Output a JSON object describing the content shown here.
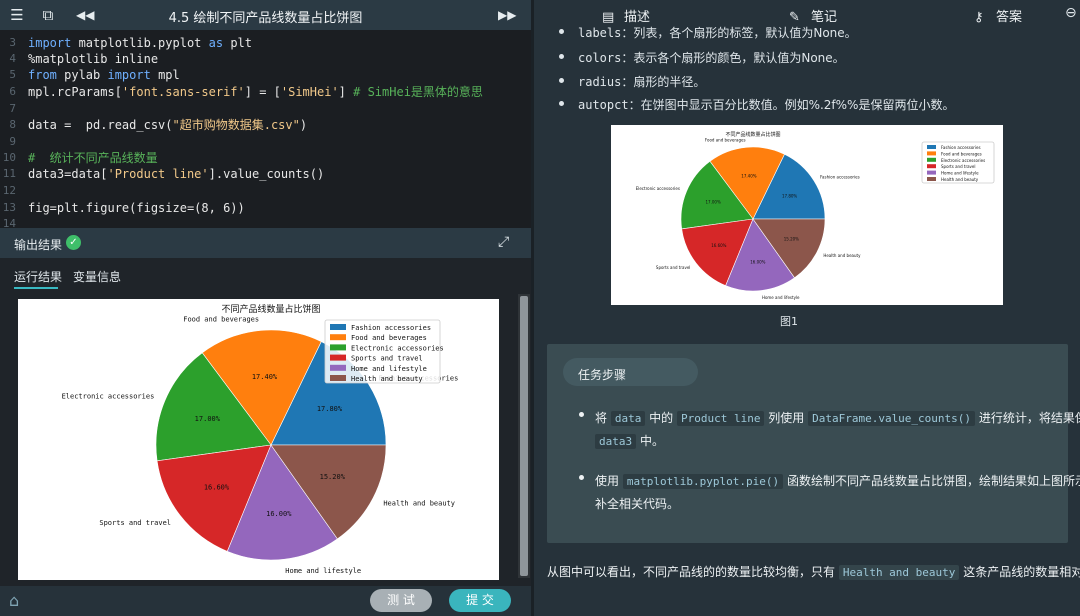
{
  "topbar": {
    "title": "4.5 绘制不同产品线数量占比饼图",
    "icons": [
      "menu-icon",
      "window-icon",
      "rewind-icon",
      "fast-forward-icon"
    ]
  },
  "editor": {
    "line_numbers": [
      "3",
      "4",
      "5",
      "6",
      "7",
      "8",
      "9",
      "10",
      "11",
      "12",
      "13",
      "14"
    ],
    "lines": [
      [
        {
          "t": "import",
          "c": "kw"
        },
        {
          "t": " matplotlib.pyplot ",
          "c": ""
        },
        {
          "t": "as",
          "c": "kw"
        },
        {
          "t": " plt",
          "c": ""
        }
      ],
      [
        {
          "t": "%matplotlib inline",
          "c": ""
        }
      ],
      [
        {
          "t": "from",
          "c": "kw"
        },
        {
          "t": " pylab ",
          "c": ""
        },
        {
          "t": "import",
          "c": "kw"
        },
        {
          "t": " mpl",
          "c": ""
        }
      ],
      [
        {
          "t": "mpl.rcParams[",
          "c": ""
        },
        {
          "t": "'font.sans-serif'",
          "c": "str"
        },
        {
          "t": "] = [",
          "c": ""
        },
        {
          "t": "'SimHei'",
          "c": "str"
        },
        {
          "t": "] ",
          "c": ""
        },
        {
          "t": "# SimHei是黑体的意思",
          "c": "cm"
        }
      ],
      [],
      [
        {
          "t": "data =  pd.read_csv(",
          "c": ""
        },
        {
          "t": "\"超市购物数据集.csv\"",
          "c": "str"
        },
        {
          "t": ")",
          "c": ""
        }
      ],
      [],
      [
        {
          "t": "#  统计不同产品线数量",
          "c": "cm"
        }
      ],
      [
        {
          "t": "data3=data[",
          "c": ""
        },
        {
          "t": "'Product line'",
          "c": "str"
        },
        {
          "t": "].value_counts()",
          "c": ""
        }
      ],
      [],
      [
        {
          "t": "fig=plt.figure(figsize=(8, 6))",
          "c": ""
        }
      ],
      []
    ]
  },
  "output": {
    "title": "输出结果",
    "tabs": [
      "运行结果",
      "变量信息"
    ],
    "active_tab": 0
  },
  "buttons": {
    "test": "测 试",
    "submit": "提 交"
  },
  "right_tabs": [
    {
      "label": "描述",
      "icon": "document-icon"
    },
    {
      "label": "笔记",
      "icon": "edit-icon"
    },
    {
      "label": "答案",
      "icon": "key-icon"
    }
  ],
  "description": {
    "bullets": [
      {
        "code": "labels",
        "text": "：列表，各个扇形的标签，默认值为None。"
      },
      {
        "code": "colors",
        "text": "：表示各个扇形的颜色，默认值为None。"
      },
      {
        "code": "radius",
        "text": "：扇形的半径。"
      },
      {
        "code": "autopct",
        "text": "：在饼图中显示百分比数值。例如%.2f%%是保留两位小数。"
      }
    ],
    "figure_caption": "图1"
  },
  "task": {
    "title": "任务步骤",
    "steps": [
      {
        "line1": [
          {
            "t": "将 ",
            "chip": false
          },
          {
            "t": "data",
            "chip": true
          },
          {
            "t": " 中的 ",
            "chip": false
          },
          {
            "t": "Product line",
            "chip": true
          },
          {
            "t": " 列使用 ",
            "chip": false
          },
          {
            "t": "DataFrame.value_counts()",
            "chip": true
          },
          {
            "t": " 进行统计，将结果保存在",
            "chip": false
          }
        ],
        "line2": [
          {
            "t": "data3",
            "chip": true
          },
          {
            "t": " 中。",
            "chip": false
          }
        ]
      },
      {
        "line1": [
          {
            "t": "使用 ",
            "chip": false
          },
          {
            "t": "matplotlib.pyplot.pie()",
            "chip": true
          },
          {
            "t": " 函数绘制不同产品线数量占比饼图，绘制结果如上图所示，",
            "chip": false
          }
        ],
        "line2": [
          {
            "t": "补全相关代码。",
            "chip": false
          }
        ]
      }
    ]
  },
  "conclusion": [
    {
      "t": "从图中可以看出，不同产品线的的数量比较均衡，只有 ",
      "chip": false
    },
    {
      "t": "Health and beauty",
      "chip": true
    },
    {
      "t": " 这条产品线的数量相对较少。",
      "chip": false
    }
  ],
  "chart_data": [
    {
      "type": "pie",
      "title": "不同产品线数量占比饼图",
      "categories": [
        "Fashion accessories",
        "Food and beverages",
        "Electronic accessories",
        "Sports and travel",
        "Home and lifestyle",
        "Health and beauty"
      ],
      "values": [
        17.8,
        17.4,
        17.0,
        16.6,
        16.0,
        15.2
      ],
      "value_labels": [
        "17.80%",
        "17.40%",
        "17.00%",
        "16.60%",
        "16.00%",
        "15.20%"
      ],
      "colors": [
        "#1f77b4",
        "#ff7f0e",
        "#2ca02c",
        "#d62728",
        "#9467bd",
        "#8c564b"
      ],
      "legend": "top-right"
    },
    {
      "type": "pie",
      "title": "不同产品线数量占比饼图",
      "categories": [
        "Fashion accessories",
        "Food and beverages",
        "Electronic accessories",
        "Sports and travel",
        "Home and lifestyle",
        "Health and beauty"
      ],
      "values": [
        17.8,
        17.4,
        17.0,
        16.6,
        16.0,
        15.2
      ],
      "value_labels": [
        "17.80%",
        "17.40%",
        "17.00%",
        "16.60%",
        "16.00%",
        "15.20%"
      ],
      "colors": [
        "#1f77b4",
        "#ff7f0e",
        "#2ca02c",
        "#d62728",
        "#9467bd",
        "#8c564b"
      ],
      "legend": "top-right"
    }
  ]
}
